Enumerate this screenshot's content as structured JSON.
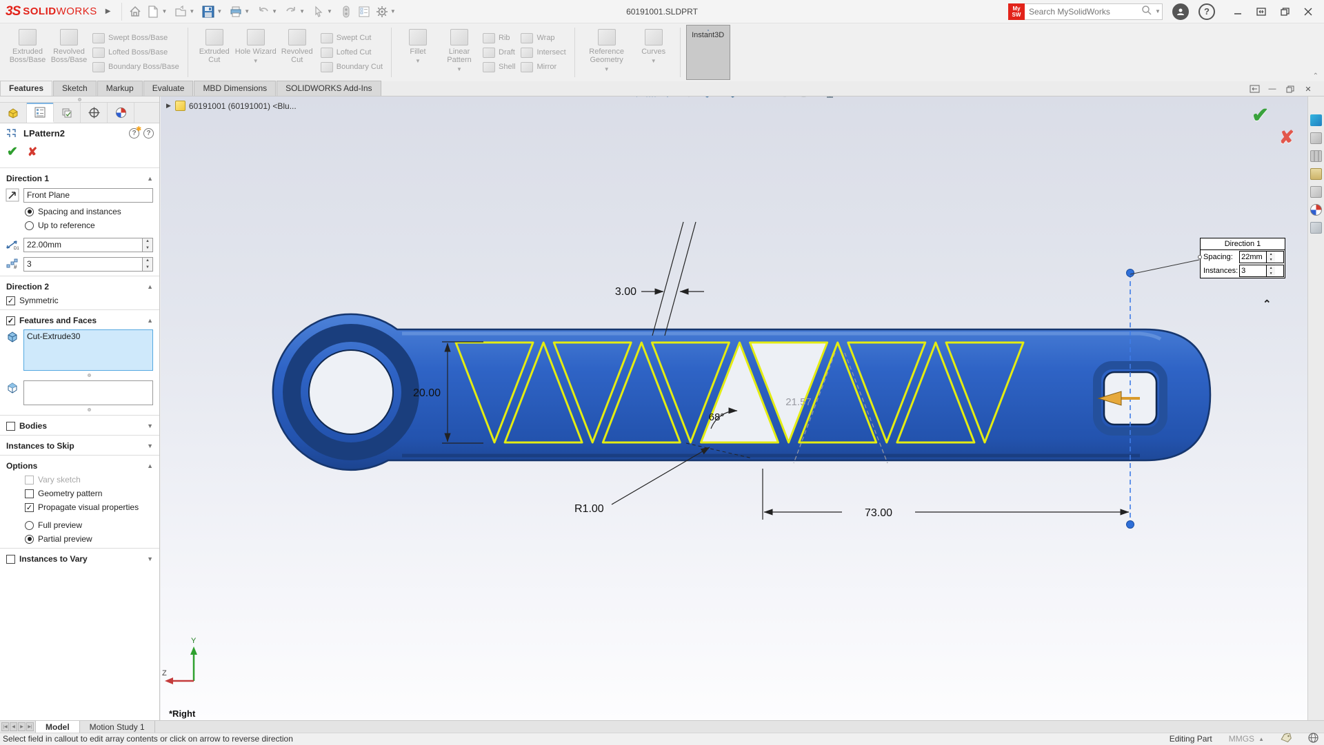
{
  "titlebar": {
    "logo_mark": "3S",
    "logo_solid": "SOLID",
    "logo_works": "WORKS",
    "document_title": "60191001.SLDPRT",
    "search_placeholder": "Search MySolidWorks",
    "mysw_line1": "My",
    "mysw_line2": "SW"
  },
  "ribbon": {
    "extruded_boss": "Extruded Boss/Base",
    "revolved_boss": "Revolved Boss/Base",
    "swept_boss": "Swept Boss/Base",
    "lofted_boss": "Lofted Boss/Base",
    "boundary_boss": "Boundary Boss/Base",
    "extruded_cut": "Extruded Cut",
    "hole_wizard": "Hole Wizard",
    "revolved_cut": "Revolved Cut",
    "swept_cut": "Swept Cut",
    "lofted_cut": "Lofted Cut",
    "boundary_cut": "Boundary Cut",
    "fillet": "Fillet",
    "linear_pattern": "Linear Pattern",
    "rib": "Rib",
    "draft": "Draft",
    "shell": "Shell",
    "wrap": "Wrap",
    "intersect": "Intersect",
    "mirror": "Mirror",
    "reference_geometry": "Reference Geometry",
    "curves": "Curves",
    "instant3d": "Instant3D"
  },
  "tabs": {
    "features": "Features",
    "sketch": "Sketch",
    "markup": "Markup",
    "evaluate": "Evaluate",
    "mbd_dimensions": "MBD Dimensions",
    "addins": "SOLIDWORKS Add-Ins"
  },
  "pm": {
    "title": "LPattern2",
    "direction1": {
      "header": "Direction 1",
      "reference": "Front Plane",
      "spacing_radio": "Spacing and instances",
      "up_to_reference_radio": "Up to reference",
      "spacing_value": "22.00mm",
      "instances_value": "3"
    },
    "direction2": {
      "header": "Direction 2",
      "symmetric": "Symmetric"
    },
    "features_faces": {
      "header": "Features and Faces",
      "selected_feature": "Cut-Extrude30"
    },
    "bodies_header": "Bodies",
    "instances_to_skip_header": "Instances to Skip",
    "options": {
      "header": "Options",
      "vary_sketch": "Vary sketch",
      "geometry_pattern": "Geometry pattern",
      "propagate": "Propagate visual properties",
      "full_preview": "Full preview",
      "partial_preview": "Partial preview"
    },
    "instances_to_vary_header": "Instances to Vary"
  },
  "viewport": {
    "tree_item": "60191001 (60191001) <Blu...",
    "view_label": "*Right",
    "dims": {
      "width": "3.00",
      "height": "20.00",
      "angle": "68°",
      "preview_spacing": "21.57",
      "radius": "R1.00",
      "length": "73.00"
    },
    "callout": {
      "title": "Direction 1",
      "spacing_label": "Spacing:",
      "spacing_value": "22mm",
      "instances_label": "Instances:",
      "instances_value": "3"
    },
    "triad": {
      "y_label": "Y",
      "z_label": "Z"
    }
  },
  "bottom": {
    "model_tab": "Model",
    "motion_study_tab": "Motion Study 1"
  },
  "statusbar": {
    "message": "Select field in callout to edit array contents or click on arrow to reverse direction",
    "mode": "Editing Part",
    "units": "MMGS"
  },
  "colors": {
    "part_blue": "#2e62c4",
    "part_blue_dark": "#173c7e",
    "preview_yellow": "#e3ec12",
    "selection_blue": "#cfe9fb",
    "brand_red": "#e2231a",
    "construction_blue": "#3f7ce6"
  }
}
